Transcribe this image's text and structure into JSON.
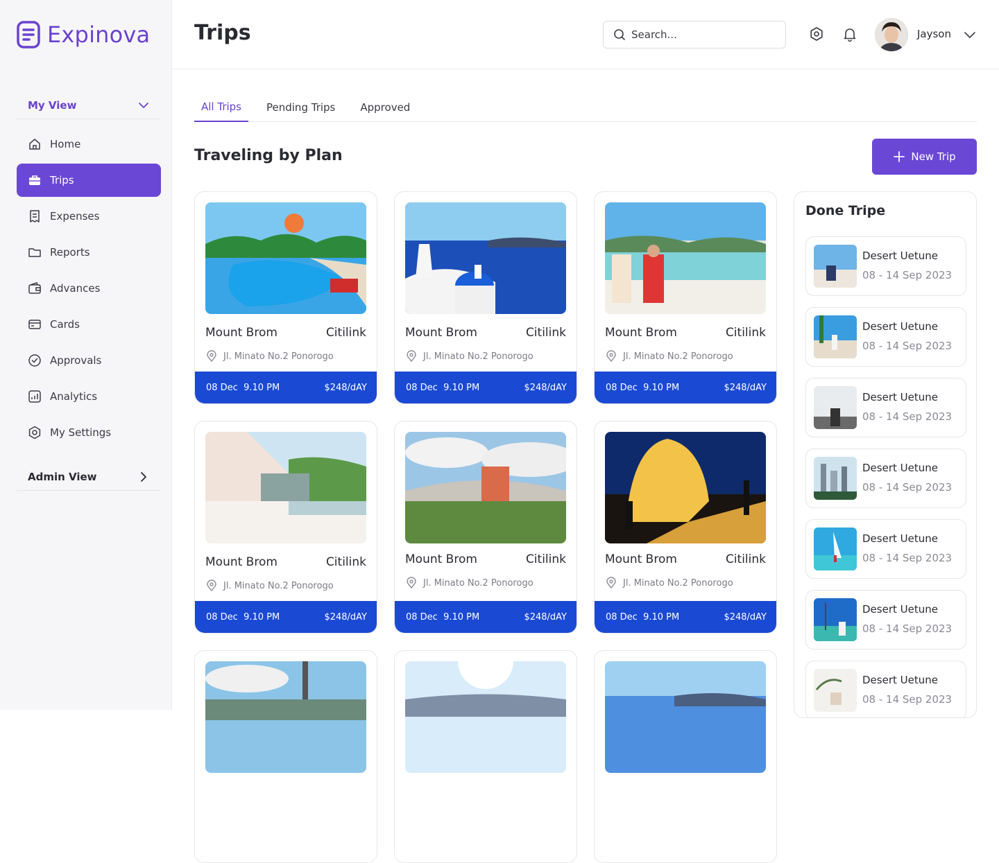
{
  "app": {
    "brand": "Expinova",
    "accent": "#6b47d6",
    "card_footer_color": "#1a49d4"
  },
  "sidebar": {
    "my_view_label": "My View",
    "admin_view_label": "Admin View",
    "items": [
      {
        "label": "Home",
        "icon": "home-icon"
      },
      {
        "label": "Trips",
        "icon": "briefcase-icon",
        "active": true
      },
      {
        "label": "Expenses",
        "icon": "receipt-icon"
      },
      {
        "label": "Reports",
        "icon": "folder-icon"
      },
      {
        "label": "Advances",
        "icon": "wallet-icon"
      },
      {
        "label": "Cards",
        "icon": "credit-card-icon"
      },
      {
        "label": "Approvals",
        "icon": "check-circle-icon"
      },
      {
        "label": "Analytics",
        "icon": "chart-icon"
      },
      {
        "label": "My Settings",
        "icon": "settings-icon"
      }
    ]
  },
  "header": {
    "title": "Trips",
    "search_placeholder": "Search...",
    "user_name": "Jayson"
  },
  "tabs": [
    {
      "label": "All Trips",
      "active": true
    },
    {
      "label": "Pending Trips"
    },
    {
      "label": "Approved"
    }
  ],
  "main": {
    "section_title": "Traveling by Plan",
    "new_trip_label": "New Trip"
  },
  "trips": [
    {
      "name": "Mount Brom",
      "airline": "Citilink",
      "location": "Jl. Minato No.2 Ponorogo",
      "date": "08 Dec",
      "time": "9.10 PM",
      "price": "$248/dAY"
    },
    {
      "name": "Mount Brom",
      "airline": "Citilink",
      "location": "Jl. Minato No.2 Ponorogo",
      "date": "08 Dec",
      "time": "9.10 PM",
      "price": "$248/dAY"
    },
    {
      "name": "Mount Brom",
      "airline": "Citilink",
      "location": "Jl. Minato No.2 Ponorogo",
      "date": "08 Dec",
      "time": "9.10 PM",
      "price": "$248/dAY"
    },
    {
      "name": "Mount Brom",
      "airline": "Citilink",
      "location": "Jl. Minato No.2 Ponorogo",
      "date": "08 Dec",
      "time": "9.10 PM",
      "price": "$248/dAY"
    },
    {
      "name": "Mount Brom",
      "airline": "Citilink",
      "location": "Jl. Minato No.2 Ponorogo",
      "date": "08 Dec",
      "time": "9.10 PM",
      "price": "$248/dAY"
    },
    {
      "name": "Mount Brom",
      "airline": "Citilink",
      "location": "Jl. Minato No.2 Ponorogo",
      "date": "08 Dec",
      "time": "9.10 PM",
      "price": "$248/dAY"
    }
  ],
  "done_panel": {
    "title": "Done Tripe",
    "items": [
      {
        "name": "Desert Uetune",
        "dates": "08 - 14 Sep 2023"
      },
      {
        "name": "Desert Uetune",
        "dates": "08 - 14 Sep 2023"
      },
      {
        "name": "Desert Uetune",
        "dates": "08 - 14 Sep 2023"
      },
      {
        "name": "Desert Uetune",
        "dates": "08 - 14 Sep 2023"
      },
      {
        "name": "Desert Uetune",
        "dates": "08 - 14 Sep 2023"
      },
      {
        "name": "Desert Uetune",
        "dates": "08 - 14 Sep 2023"
      },
      {
        "name": "Desert Uetune",
        "dates": "08 - 14 Sep 2023"
      }
    ]
  }
}
